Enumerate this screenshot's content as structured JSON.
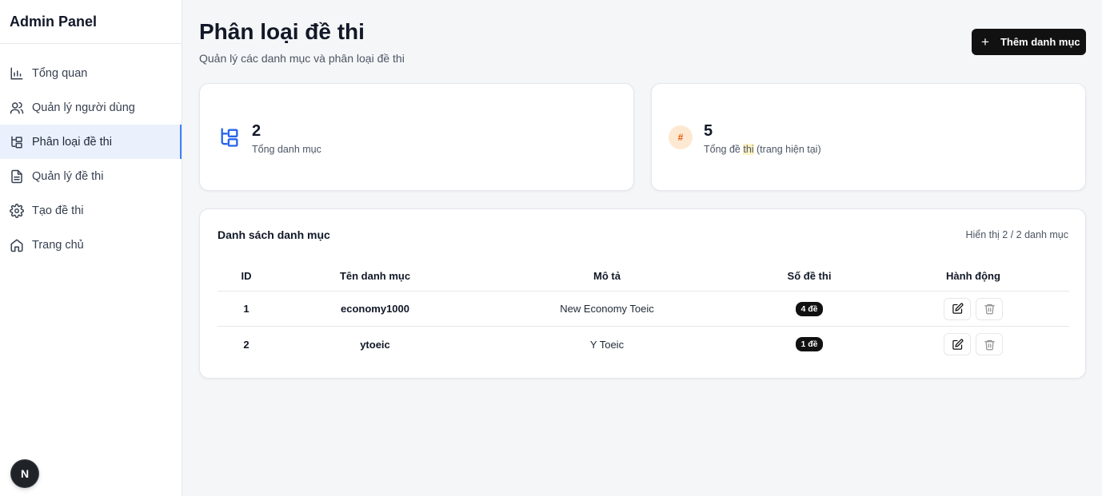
{
  "sidebar": {
    "brand": "Admin Panel",
    "items": [
      {
        "label": "Tổng quan",
        "icon": "bar-chart-icon"
      },
      {
        "label": "Quản lý người dùng",
        "icon": "users-icon"
      },
      {
        "label": "Phân loại đề thi",
        "icon": "folder-tree-icon",
        "active": true
      },
      {
        "label": "Quản lý đề thi",
        "icon": "document-icon"
      },
      {
        "label": "Tạo đề thi",
        "icon": "gear-icon"
      },
      {
        "label": "Trang chủ",
        "icon": "home-icon"
      }
    ],
    "badge": "N"
  },
  "header": {
    "title": "Phân loại đề thi",
    "subtitle": "Quản lý các danh mục và phân loại đề thi",
    "add_label": "Thêm danh mục",
    "add_icon": "+"
  },
  "stats": [
    {
      "value": "2",
      "label": "Tổng danh mục",
      "icon": "folder-tree-icon",
      "color": "#2563eb"
    },
    {
      "value": "5",
      "label_pre": "Tổng đề ",
      "label_hl": "thi",
      "label_post": " (trang hiện tại)",
      "icon": "#",
      "color": "#ea580c"
    }
  ],
  "table": {
    "title": "Danh sách danh mục",
    "count": "Hiển thị 2 / 2 danh mục",
    "columns": [
      "ID",
      "Tên danh mục",
      "Mô tả",
      "Số đề thi",
      "Hành động"
    ],
    "rows": [
      {
        "id": "1",
        "name": "economy1000",
        "desc": "New Economy Toeic",
        "count": "4 đề"
      },
      {
        "id": "2",
        "name": "ytoeic",
        "desc": "Y Toeic",
        "count": "1 đề"
      }
    ]
  },
  "colors": {
    "accent": "#3b82f6",
    "active_bg": "#eaf1fd",
    "button": "#111111"
  }
}
